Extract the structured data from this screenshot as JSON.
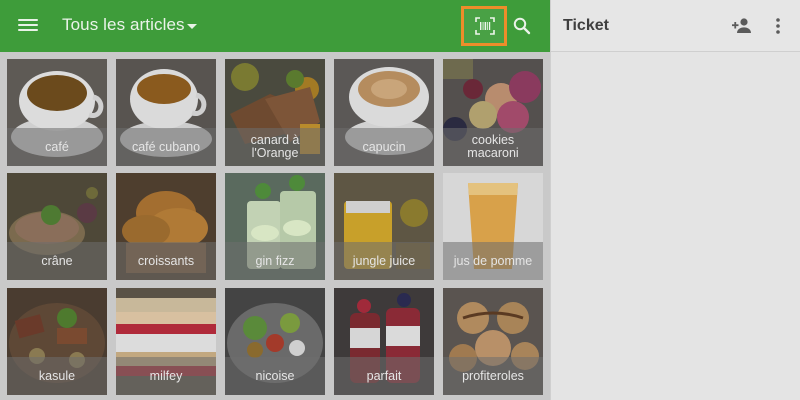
{
  "topbar": {
    "menu_icon": "hamburger-menu-icon",
    "title": "Tous les articles",
    "dropdown_icon": "caret-down-icon",
    "barcode_icon": "barcode-scan-icon",
    "search_icon": "search-icon",
    "bg_color": "#3e9c3a",
    "highlight_color": "#ee8d2a"
  },
  "items": [
    {
      "label": "café",
      "scene": "coffee"
    },
    {
      "label": "café cubano",
      "scene": "coffee2"
    },
    {
      "label": "canard à l'Orange",
      "scene": "duck"
    },
    {
      "label": "capucin",
      "scene": "coffee3"
    },
    {
      "label": "cookies macaroni",
      "scene": "macarons"
    },
    {
      "label": "crâne",
      "scene": "pate"
    },
    {
      "label": "croissants",
      "scene": "croissant"
    },
    {
      "label": "gin fizz",
      "scene": "ginfizz"
    },
    {
      "label": "jungle juice",
      "scene": "juice"
    },
    {
      "label": "jus de pomme",
      "scene": "applejuice"
    },
    {
      "label": "kasule",
      "scene": "kasule"
    },
    {
      "label": "milfey",
      "scene": "millefeuille"
    },
    {
      "label": "nicoise",
      "scene": "salad"
    },
    {
      "label": "parfait",
      "scene": "parfait"
    },
    {
      "label": "profiteroles",
      "scene": "profiteroles"
    }
  ],
  "ticket": {
    "title": "Ticket",
    "add_person_icon": "add-person-icon",
    "more_icon": "more-vertical-icon"
  }
}
